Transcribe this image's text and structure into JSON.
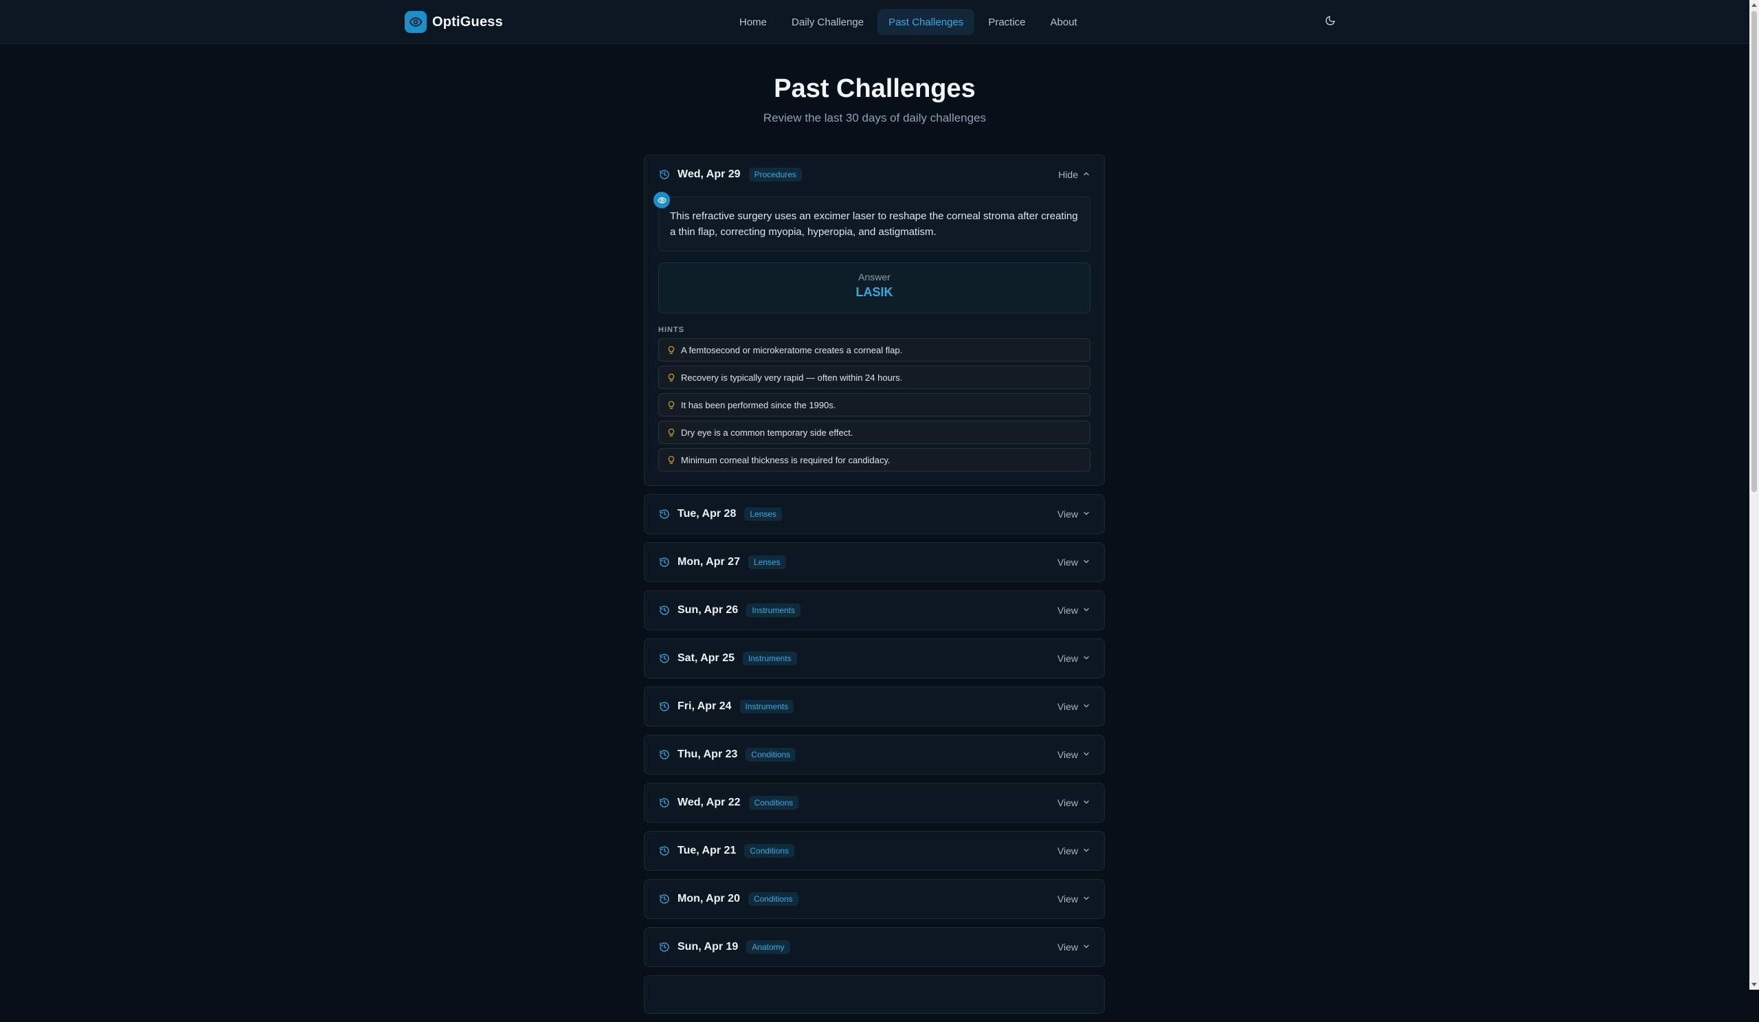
{
  "app": {
    "name": "OptiGuess"
  },
  "nav": {
    "items": [
      {
        "label": "Home",
        "active": false
      },
      {
        "label": "Daily Challenge",
        "active": false
      },
      {
        "label": "Past Challenges",
        "active": true
      },
      {
        "label": "Practice",
        "active": false
      },
      {
        "label": "About",
        "active": false
      }
    ]
  },
  "page": {
    "title": "Past Challenges",
    "subtitle": "Review the last 30 days of daily challenges"
  },
  "expanded": {
    "date": "Wed, Apr 29",
    "tag": "Procedures",
    "toggle_label": "Hide",
    "question": "This refractive surgery uses an excimer laser to reshape the corneal stroma after creating a thin flap, correcting myopia, hyperopia, and astigmatism.",
    "answer_label": "Answer",
    "answer": "LASIK",
    "hints_label": "HINTS",
    "hints": [
      "A femtosecond or microkeratome creates a corneal flap.",
      "Recovery is typically very rapid — often within 24 hours.",
      "It has been performed since the 1990s.",
      "Dry eye is a common temporary side effect.",
      "Minimum corneal thickness is required for candidacy."
    ]
  },
  "collapsed": [
    {
      "date": "Tue, Apr 28",
      "tag": "Lenses",
      "toggle_label": "View"
    },
    {
      "date": "Mon, Apr 27",
      "tag": "Lenses",
      "toggle_label": "View"
    },
    {
      "date": "Sun, Apr 26",
      "tag": "Instruments",
      "toggle_label": "View"
    },
    {
      "date": "Sat, Apr 25",
      "tag": "Instruments",
      "toggle_label": "View"
    },
    {
      "date": "Fri, Apr 24",
      "tag": "Instruments",
      "toggle_label": "View"
    },
    {
      "date": "Thu, Apr 23",
      "tag": "Conditions",
      "toggle_label": "View"
    },
    {
      "date": "Wed, Apr 22",
      "tag": "Conditions",
      "toggle_label": "View"
    },
    {
      "date": "Tue, Apr 21",
      "tag": "Conditions",
      "toggle_label": "View"
    },
    {
      "date": "Mon, Apr 20",
      "tag": "Conditions",
      "toggle_label": "View"
    },
    {
      "date": "Sun, Apr 19",
      "tag": "Anatomy",
      "toggle_label": "View"
    }
  ],
  "colors": {
    "accent": "#3aa9e3",
    "background": "#070f18",
    "card": "#0c1722",
    "hint_bulb": "#d9a23a"
  }
}
